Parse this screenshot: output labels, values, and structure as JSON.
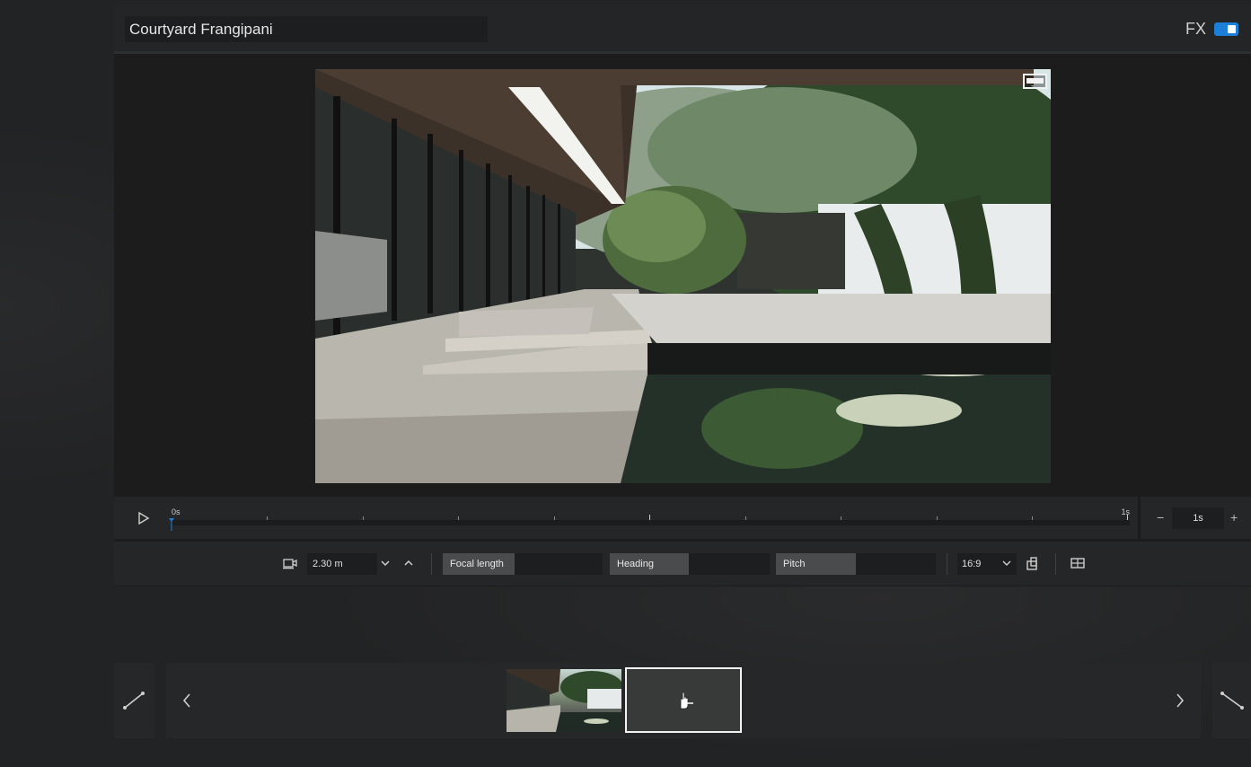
{
  "scene": {
    "title": "Courtyard Frangipani",
    "fx_label": "FX",
    "fx_enabled": true,
    "accent_color": "#1e7fd8"
  },
  "timeline": {
    "start_label": "0s",
    "end_label": "1s",
    "playhead_position": 0,
    "duration_value": "1s",
    "decrement_label": "−",
    "increment_label": "+"
  },
  "camera": {
    "distance": "2.30 m",
    "focal_length_label": "Focal length",
    "focal_length_value": "",
    "heading_label": "Heading",
    "heading_value": "",
    "pitch_label": "Pitch",
    "pitch_value": "",
    "aspect_ratio": "16:9"
  },
  "icons": {
    "play": "play-icon",
    "camera": "video-camera-icon",
    "chevron_down": "chevron-down-icon",
    "chevron_up": "chevron-up-icon",
    "fullscreen": "fullscreen-icon",
    "rotate_frame": "rotate-frame-icon",
    "safe_frame": "safe-frame-icon",
    "path_start": "path-start-icon",
    "path_end": "path-end-icon",
    "prev": "chevron-left-icon",
    "next": "chevron-right-icon",
    "add_keyframe": "hand-pointer-icon"
  }
}
